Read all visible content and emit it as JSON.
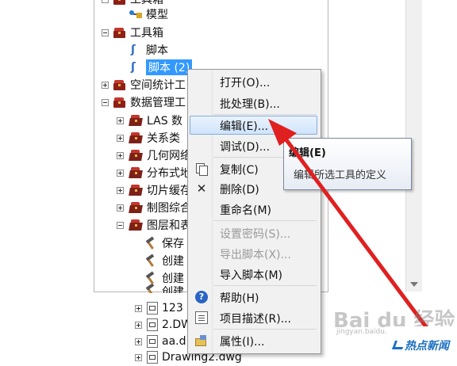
{
  "tree": {
    "nodes": [
      {
        "label": "工具箱"
      },
      {
        "label": "模型"
      },
      {
        "label": "工具箱"
      },
      {
        "label": "脚本"
      },
      {
        "label": "脚本 (2)"
      },
      {
        "label": "空间统计工"
      },
      {
        "label": "数据管理工"
      },
      {
        "label": "LAS 数"
      },
      {
        "label": "关系类"
      },
      {
        "label": "几何网络"
      },
      {
        "label": "分布式地"
      },
      {
        "label": "切片缓存"
      },
      {
        "label": "制图综合"
      },
      {
        "label": "图层和表"
      },
      {
        "label": "保存"
      },
      {
        "label": "创建"
      },
      {
        "label": "创建"
      },
      {
        "label": "创建"
      },
      {
        "label": "123"
      },
      {
        "label": "2.DW"
      },
      {
        "label": "aa.d"
      },
      {
        "label": "Drawing2.dwg"
      }
    ]
  },
  "context_menu": {
    "items": [
      {
        "label": "打开(O)...",
        "icon": "",
        "disabled": false
      },
      {
        "label": "批处理(B)...",
        "icon": "",
        "disabled": false
      },
      {
        "label": "编辑(E)...",
        "icon": "",
        "disabled": false,
        "hover": true
      },
      {
        "label": "调试(D)...",
        "icon": "",
        "disabled": false
      },
      {
        "label": "复制(C)",
        "icon": "copy-icon",
        "disabled": false
      },
      {
        "label": "删除(D)",
        "icon": "delete-icon",
        "disabled": false
      },
      {
        "label": "重命名(M)",
        "icon": "",
        "disabled": false
      },
      {
        "label": "设置密码(S)...",
        "icon": "",
        "disabled": true
      },
      {
        "label": "导出脚本(X)...",
        "icon": "",
        "disabled": true
      },
      {
        "label": "导入脚本(M)",
        "icon": "",
        "disabled": false
      },
      {
        "label": "帮助(H)",
        "icon": "help-icon",
        "disabled": false
      },
      {
        "label": "项目描述(R)...",
        "icon": "description-icon",
        "disabled": false
      },
      {
        "label": "属性(I)...",
        "icon": "properties-icon",
        "disabled": false
      }
    ]
  },
  "tooltip": {
    "title": "编辑(E)",
    "description": "编辑所选工具的定义"
  },
  "watermark": {
    "text": "Bai du 经验",
    "sub": "jingyan.baidu.com"
  },
  "badge": {
    "text": "热点新闻"
  },
  "colors": {
    "selection": "#3399ff",
    "arrow": "#e02020",
    "badge": "#1b6fc2"
  }
}
